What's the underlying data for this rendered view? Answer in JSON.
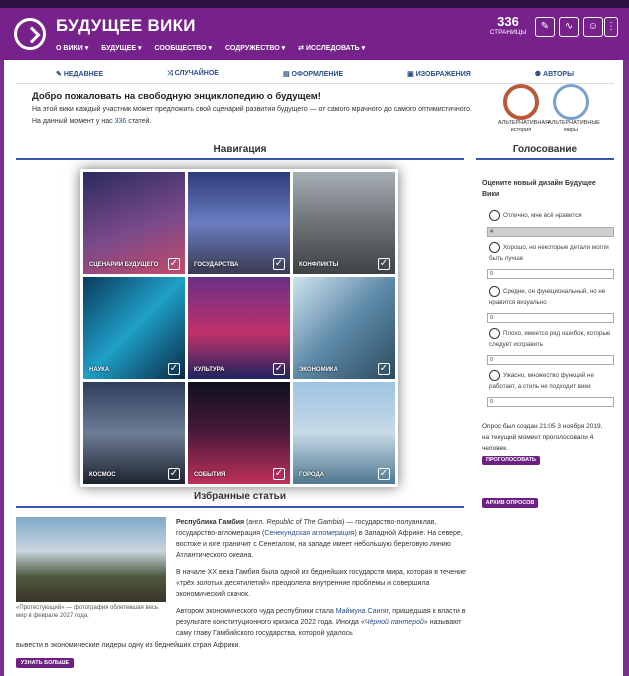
{
  "header": {
    "site_title": "БУДУЩЕЕ ВИКИ",
    "nav": [
      "О ВИКИ",
      "БУДУЩЕЕ",
      "СООБЩЕСТВО",
      "СОДРУЖЕСТВО",
      "ИССЛЕДОВАТЬ"
    ],
    "page_count": "336",
    "page_count_label": "СТРАНИЦЫ"
  },
  "tabs": [
    "НЕДАВНЕЕ",
    "СЛУЧАЙНОЕ",
    "ОФОРМЛЕНИЕ",
    "ИЗОБРАЖЕНИЯ",
    "АВТОРЫ"
  ],
  "welcome": {
    "title": "Добро пожаловать на свободную энциклопедию о будущем!",
    "line1": "На этой вики каждый участник может предложить свой сценарий развития будущего — от самого мрачного до самого оптимистичного.",
    "line2_pre": "На данный момент у нас ",
    "article_count": "336",
    "line2_post": " статей."
  },
  "partners": [
    {
      "caption": "АЛЬТЕРНАТИВНАЯ история"
    },
    {
      "caption": "АЛЬТЕРНАТИВНЫЕ миры"
    }
  ],
  "navigation": {
    "heading": "Навигация",
    "tiles": [
      {
        "label": "СЦЕНАРИИ БУДУЩЕГО"
      },
      {
        "label": "ГОСУДАРСТВА"
      },
      {
        "label": "КОНФЛИКТЫ"
      },
      {
        "label": "НАУКА"
      },
      {
        "label": "КУЛЬТУРА"
      },
      {
        "label": "ЭКОНОМИКА"
      },
      {
        "label": "КОСМОС"
      },
      {
        "label": "СОБЫТИЯ"
      },
      {
        "label": "ГОРОДА"
      }
    ]
  },
  "featured": {
    "heading": "Избранные статьи",
    "image_caption": "«Протестующий» — фотография облетевшая весь мир в феврале 2027 года.",
    "p1_title": "Республика Гамбия",
    "p1_a": " (англ. ",
    "p1_italic": "Republic of The Gambia",
    "p1_b": ") — государство-полуанклав, государство-агломерация (",
    "p1_link": "Сенекундская агломерация",
    "p1_c": ") в Западной Африке. На севере, востоке и юге граничит с Сенегалом, на западе имеет небольшую береговую линию Атлантического океана.",
    "p2": "В начале XX века Гамбия была одной из беднейших государств мира, которая в течение «трёх золотых десятилетий» преодолела внутренние проблемы и совершила экономический скачок.",
    "p3_a": "Автором экономического чуда республики стала ",
    "p3_link": "Маймуна Сангяг",
    "p3_b": ", пришедшая к власти в результате конституционного кризиса 2022 года. Иногда «",
    "p3_italic": "Чёрной пантерой",
    "p3_c": "» называют саму главу Гамбийского государства, которой удалось",
    "p3_d": "вывести в экономические лидеры одну из беднейших стран Африки.",
    "button": "УЗНАТЬ БОЛЬШЕ"
  },
  "poll": {
    "heading": "Голосование",
    "question": "Оцените новый дизайн Будущее Вики",
    "options": [
      {
        "label": "Отлично, мне всё нравится",
        "count": "4",
        "share": 1
      },
      {
        "label": "Хорошо, но некоторые детали могли быть лучше",
        "count": "0",
        "share": 0
      },
      {
        "label": "Средне, он функциональный, но не нравится визуально",
        "count": "0",
        "share": 0
      },
      {
        "label": "Плохо, имеется ряд ошибок, которые следует исправить",
        "count": "0",
        "share": 0
      },
      {
        "label": "Ужасно, множество функций не работает, а стиль не подходит вики",
        "count": "0",
        "share": 0
      }
    ],
    "meta": "Опрос был создан 21:05 3 ноября 2019, на текущий момент проголосовали 4 человек.",
    "vote_button": "ПРОГОЛОСОВАТЬ",
    "archive_button": "АРХИВ ОПРОСОВ"
  },
  "colors": {
    "brand": "#77218b",
    "accent": "#3558a8",
    "button": "#6d1f84"
  }
}
